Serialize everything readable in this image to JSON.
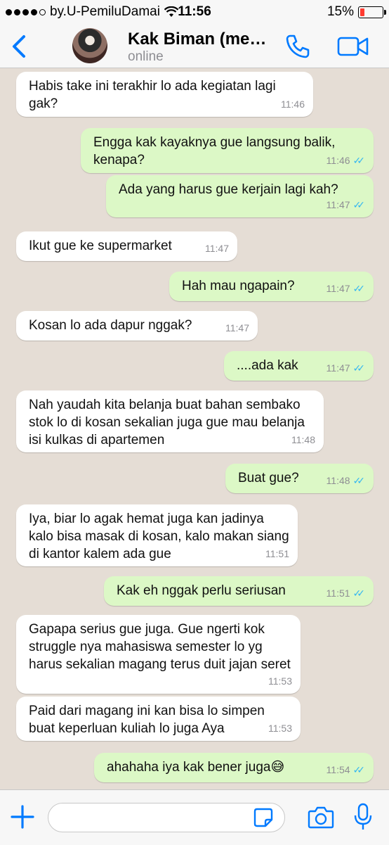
{
  "status_bar": {
    "carrier": "by.U-PemiluDamai",
    "time": "11:56",
    "battery": "15%"
  },
  "header": {
    "contact_name": "Kak Biman (me…",
    "contact_status": "online",
    "icons": [
      "back-chevron-icon",
      "phone-icon",
      "video-camera-icon"
    ]
  },
  "messages": [
    {
      "dir": "in",
      "text": "Habis take ini terakhir lo ada kegiatan lagi gak?",
      "time": "11:46"
    },
    {
      "dir": "out",
      "text": "Engga kak kayaknya gue langsung balik, kenapa?",
      "time": "11:46"
    },
    {
      "dir": "out",
      "text": "Ada yang harus gue kerjain lagi kah?",
      "time": "11:47"
    },
    {
      "dir": "in",
      "text": "Ikut gue ke supermarket",
      "time": "11:47"
    },
    {
      "dir": "out",
      "text": "Hah mau ngapain?",
      "time": "11:47"
    },
    {
      "dir": "in",
      "text": "Kosan lo ada dapur nggak?",
      "time": "11:47"
    },
    {
      "dir": "out",
      "text": "....ada kak",
      "time": "11:47"
    },
    {
      "dir": "in",
      "text": "Nah yaudah kita belanja buat bahan sembako stok lo di kosan sekalian juga gue mau belanja isi kulkas di apartemen",
      "time": "11:48"
    },
    {
      "dir": "out",
      "text": "Buat gue?",
      "time": "11:48"
    },
    {
      "dir": "in",
      "text": "Iya, biar lo agak hemat juga kan jadinya kalo bisa masak di kosan, kalo makan siang di kantor kalem ada gue",
      "time": "11:51"
    },
    {
      "dir": "out",
      "text": "Kak eh nggak perlu seriusan",
      "time": "11:51"
    },
    {
      "dir": "in",
      "text": "Gapapa serius gue juga. Gue ngerti kok struggle nya mahasiswa semester lo yg harus sekalian magang terus duit jajan seret",
      "time": "11:53"
    },
    {
      "dir": "in",
      "text": "Paid dari magang ini kan bisa lo simpen buat keperluan kuliah lo juga Aya",
      "time": "11:53"
    },
    {
      "dir": "out",
      "text": "ahahaha iya kak bener juga😅",
      "time": "11:54"
    }
  ],
  "read_receipt": "✓✓",
  "composer": {
    "placeholder": "",
    "icons": [
      "plus-icon",
      "sticker-icon",
      "camera-icon",
      "microphone-icon"
    ]
  },
  "colors": {
    "accent": "#007aff",
    "incoming_bubble": "#ffffff",
    "outgoing_bubble": "#dcf8c6",
    "chat_background": "#e5ddd5",
    "read_tick": "#34b7f1"
  }
}
